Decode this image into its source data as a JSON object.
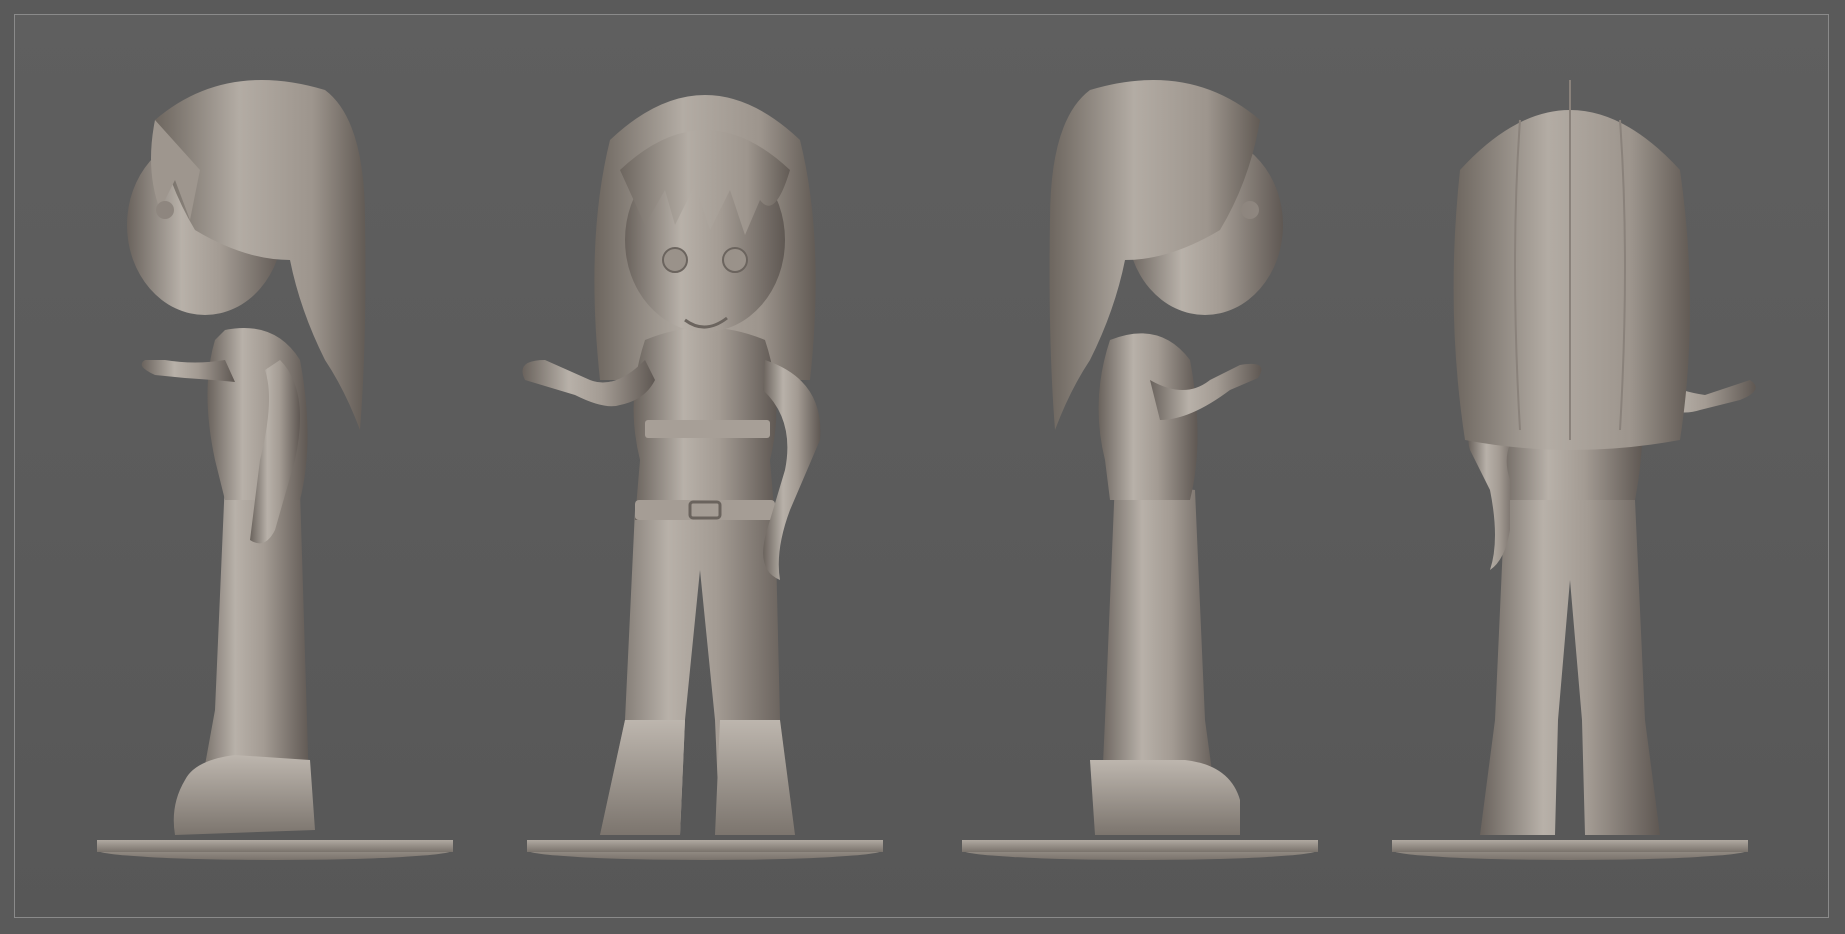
{
  "scene": {
    "subject": "",
    "views": [
      {
        "id": "side-left",
        "pose": "side"
      },
      {
        "id": "front",
        "pose": "front"
      },
      {
        "id": "side-right",
        "pose": "side-mirrored"
      },
      {
        "id": "back",
        "pose": "back"
      }
    ]
  },
  "colors": {
    "background": "#5a5a5a",
    "border": "#8a8a8a",
    "clay_light": "#b5aea6",
    "clay_mid": "#8f8780",
    "clay_dark": "#5e5853",
    "base": "#a59e97"
  }
}
